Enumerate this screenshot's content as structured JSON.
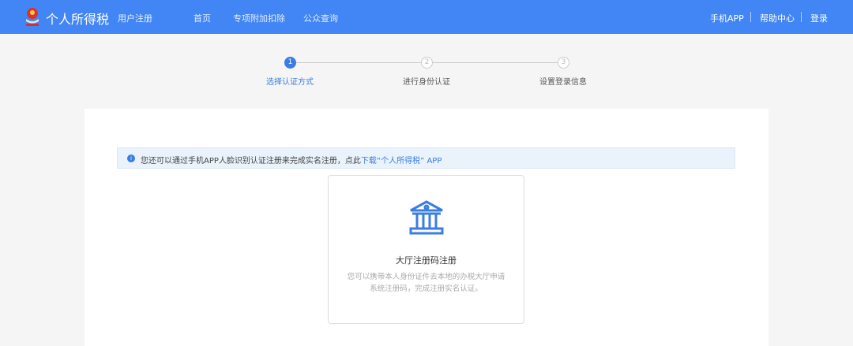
{
  "header": {
    "brand": "个人所得税",
    "subtitle": "用户注册",
    "nav": [
      "首页",
      "专项附加扣除",
      "公众查询"
    ],
    "right": [
      "手机APP",
      "帮助中心",
      "登录"
    ]
  },
  "steps": [
    {
      "num": "1",
      "label": "选择认证方式",
      "active": true
    },
    {
      "num": "2",
      "label": "进行身份认证",
      "active": false
    },
    {
      "num": "3",
      "label": "设置登录信息",
      "active": false
    }
  ],
  "tip": {
    "icon": "info-icon",
    "text": "您还可以通过手机APP人脸识别认证注册来完成实名注册，点此",
    "link": "下载",
    "suffix": "“个人所得税” APP"
  },
  "card": {
    "icon": "bank-building-icon",
    "title": "大厅注册码注册",
    "desc1": "您可以携带本人身份证件去本地的办税大厅申请",
    "desc2": "系统注册码，完成注册实名认证。"
  },
  "colors": {
    "header": "#4285f4",
    "accent": "#3b7de0"
  }
}
